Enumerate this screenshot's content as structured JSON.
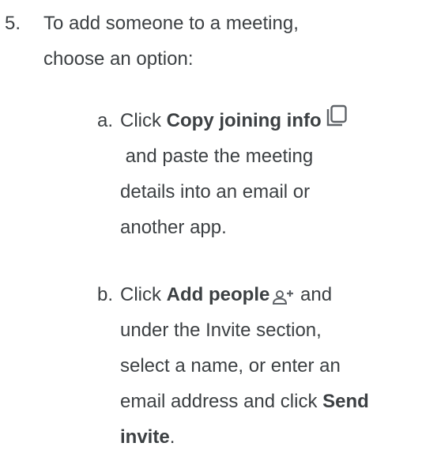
{
  "step": {
    "number": "5.",
    "line1": "To add someone to a meeting,",
    "line2": "choose an option:"
  },
  "options": [
    {
      "letter": "a.",
      "click_prefix": "Click ",
      "action_label": "Copy joining info",
      "icon": "copy-icon",
      "line2": " and paste the meeting",
      "line3": "details into an email or",
      "line4": "another app."
    },
    {
      "letter": "b.",
      "click_prefix": "Click ",
      "action_label": "Add people",
      "icon": "person-add-icon",
      "after_icon": " and",
      "line2": "under the Invite section,",
      "line3": "select a name, or enter an",
      "line4_prefix": "email address and click ",
      "line4_bold": "Send",
      "line5_bold": "invite",
      "line5_suffix": "."
    }
  ],
  "colors": {
    "text": "#3c4043",
    "icon": "#5f6368",
    "background": "#ffffff"
  }
}
